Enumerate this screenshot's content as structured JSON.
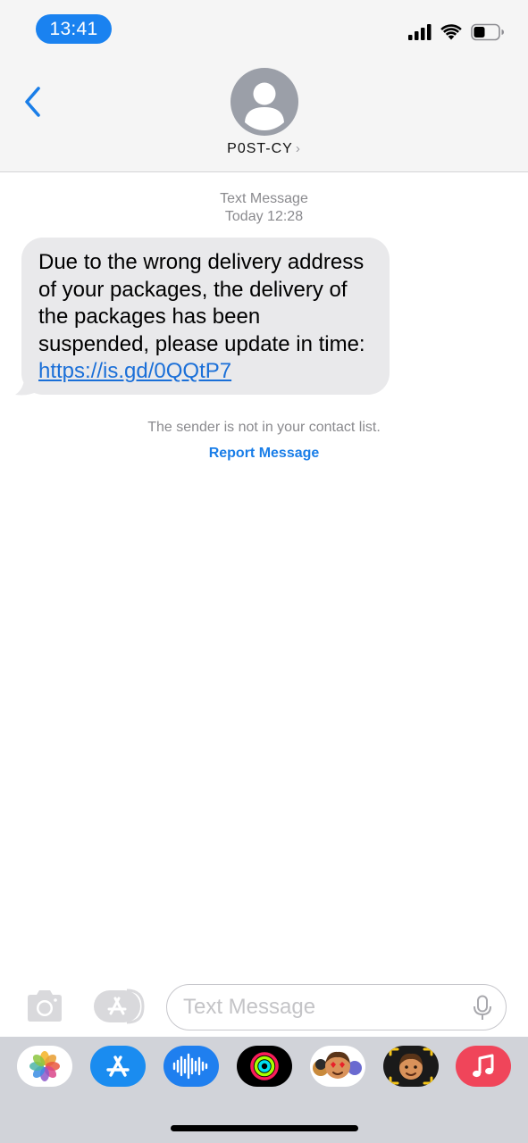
{
  "status_bar": {
    "time": "13:41",
    "icons": [
      "cellular-signal-icon",
      "wifi-icon",
      "battery-icon"
    ],
    "accent_color": "#1a82f0"
  },
  "header": {
    "contact_name": "P0ST-CY",
    "icons": [
      "back-chevron-icon",
      "person-avatar-icon",
      "chevron-right-icon"
    ]
  },
  "conversation": {
    "service_label": "Text Message",
    "timestamp": "Today 12:28",
    "message_text": "Due to the wrong delivery address of your packages, the delivery of the packages has been suspended, please update in time: ",
    "message_link": "https://is.gd/0QQtP7",
    "notice": "The sender is not in your contact list.",
    "report_label": "Report Message",
    "link_color": "#1a6fd8"
  },
  "compose": {
    "placeholder": "Text Message",
    "icons": [
      "camera-icon",
      "app-store-icon",
      "microphone-icon"
    ]
  },
  "app_drawer": {
    "apps": [
      "photos-icon",
      "app-store-icon",
      "audio-message-icon",
      "activity-icon",
      "memoji-stickers-icon",
      "memoji-icon",
      "music-icon"
    ]
  }
}
